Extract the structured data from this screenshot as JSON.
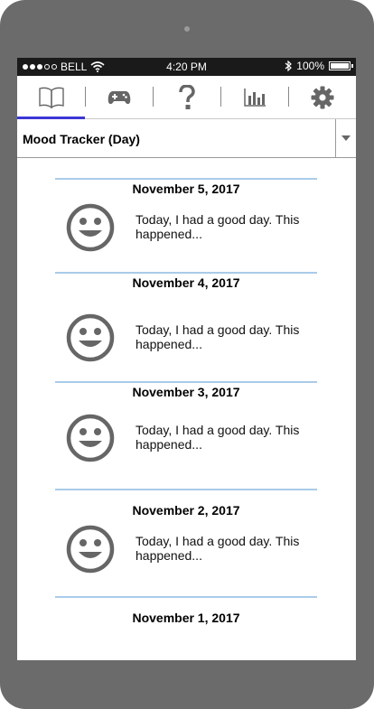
{
  "status_bar": {
    "carrier": "BELL",
    "time": "4:20 PM",
    "battery": "100%",
    "signal_dots_filled": 3,
    "signal_dots_total": 5
  },
  "nav": {
    "tabs": [
      {
        "icon": "book-icon",
        "active": true
      },
      {
        "icon": "gamepad-icon",
        "active": false
      },
      {
        "icon": "question-icon",
        "active": false
      },
      {
        "icon": "bar-chart-icon",
        "active": false
      },
      {
        "icon": "gear-icon",
        "active": false
      }
    ],
    "active_color": "#3b36d4"
  },
  "selector": {
    "value": "Mood Tracker (Day)"
  },
  "entries": [
    {
      "date": "November 5, 2017",
      "mood": "smiley-face-icon",
      "text": "Today, I had a good day. This happened..."
    },
    {
      "date": "November 4, 2017",
      "mood": "smiley-face-icon",
      "text": "Today, I had a good day. This happened..."
    },
    {
      "date": "November 3, 2017",
      "mood": "smiley-face-icon",
      "text": "Today, I had a good day. This happened..."
    },
    {
      "date": "November 2, 2017",
      "mood": "smiley-face-icon",
      "text": "Today, I had a good day. This happened..."
    },
    {
      "date": "November 1, 2017",
      "mood": "",
      "text": ""
    }
  ],
  "colors": {
    "divider": "#a9cbe9",
    "icon_gray": "#666666",
    "frame": "#6b6b6b"
  }
}
